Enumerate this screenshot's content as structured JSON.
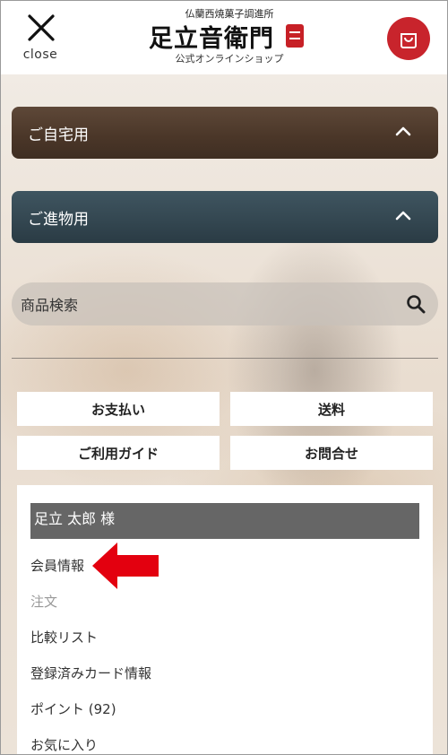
{
  "header": {
    "close_label": "close",
    "logo_subtitle": "仏蘭西焼菓子調進所",
    "logo_name": "足立音衛門",
    "logo_caption": "公式オンラインショップ"
  },
  "categories": [
    {
      "label": "ご自宅用"
    },
    {
      "label": "ご進物用"
    }
  ],
  "search": {
    "label": "商品検索"
  },
  "info_buttons": [
    {
      "label": "お支払い"
    },
    {
      "label": "送料"
    },
    {
      "label": "ご利用ガイド"
    },
    {
      "label": "お問合せ"
    }
  ],
  "account": {
    "user_name": "足立 太郎 様",
    "menu": [
      {
        "label": "会員情報"
      },
      {
        "label": "注文"
      },
      {
        "label": "比較リスト"
      },
      {
        "label": "登録済みカード情報"
      },
      {
        "label": "ポイント (92)"
      },
      {
        "label": "お気に入り"
      }
    ]
  },
  "colors": {
    "accent_red": "#c8242c",
    "arrow_red": "#e3000f"
  }
}
